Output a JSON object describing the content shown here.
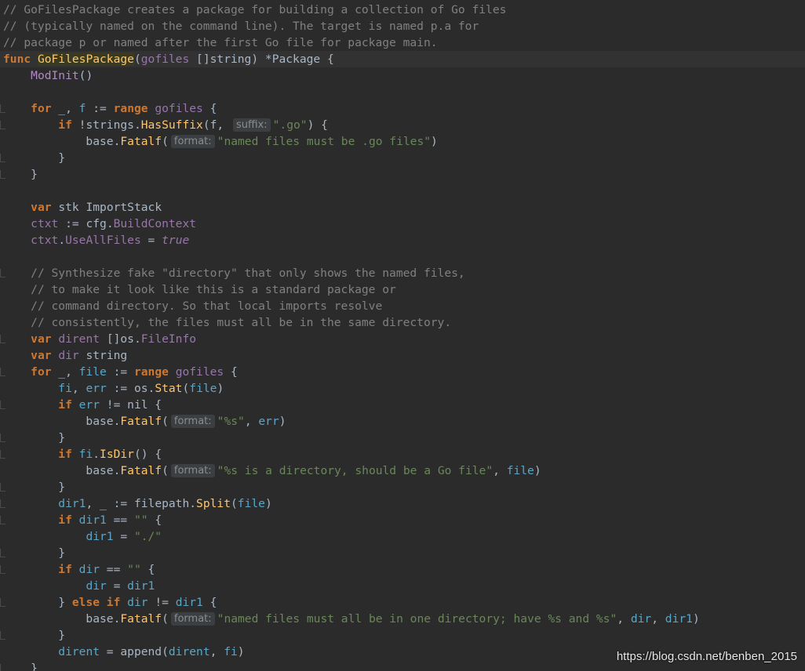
{
  "editor": {
    "language": "go",
    "current_line": 3,
    "lines": [
      [
        [
          "c",
          "// GoFilesPackage creates a package for building a collection of Go files"
        ]
      ],
      [
        [
          "c",
          "// (typically named on the command line). The target is named p.a for"
        ]
      ],
      [
        [
          "c",
          "// package p or named after the first Go file for package main."
        ]
      ],
      [
        [
          "k",
          "func "
        ],
        [
          "fn",
          "GoFilesPackage"
        ],
        [
          "pl",
          "("
        ],
        [
          "v",
          "gofiles"
        ],
        [
          "pl",
          " []string) *Package {"
        ]
      ],
      [
        [
          "pl",
          "    "
        ],
        [
          "pc",
          "ModInit"
        ],
        [
          "pl",
          "()"
        ]
      ],
      [],
      [
        [
          "pl",
          "    "
        ],
        [
          "k",
          "for "
        ],
        [
          "pl",
          "_, "
        ],
        [
          "pv",
          "f"
        ],
        [
          "pl",
          " := "
        ],
        [
          "k",
          "range "
        ],
        [
          "v",
          "gofiles"
        ],
        [
          "pl",
          " {"
        ]
      ],
      [
        [
          "pl",
          "        "
        ],
        [
          "k",
          "if "
        ],
        [
          "pl",
          "!strings."
        ],
        [
          "m",
          "HasSuffix"
        ],
        [
          "pl",
          "(f, "
        ],
        [
          "hint",
          "suffix:"
        ],
        [
          "s",
          "\".go\""
        ],
        [
          "pl",
          ") {"
        ]
      ],
      [
        [
          "pl",
          "            base."
        ],
        [
          "m",
          "Fatalf"
        ],
        [
          "pl",
          "("
        ],
        [
          "hint",
          "format:"
        ],
        [
          "s",
          "\"named files must be .go files\""
        ],
        [
          "pl",
          ")"
        ]
      ],
      [
        [
          "pl",
          "        }"
        ]
      ],
      [
        [
          "pl",
          "    }"
        ]
      ],
      [],
      [
        [
          "pl",
          "    "
        ],
        [
          "k",
          "var "
        ],
        [
          "pl",
          "stk "
        ],
        [
          "t",
          "ImportStack"
        ]
      ],
      [
        [
          "pl",
          "    "
        ],
        [
          "v",
          "ctxt"
        ],
        [
          "pl",
          " := cfg."
        ],
        [
          "v",
          "BuildContext"
        ]
      ],
      [
        [
          "pl",
          "    "
        ],
        [
          "v",
          "ctxt"
        ],
        [
          "pl",
          "."
        ],
        [
          "v",
          "UseAllFiles"
        ],
        [
          "pl",
          " = "
        ],
        [
          "i",
          "true"
        ]
      ],
      [],
      [
        [
          "pl",
          "    "
        ],
        [
          "c",
          "// Synthesize fake \"directory\" that only shows the named files,"
        ]
      ],
      [
        [
          "pl",
          "    "
        ],
        [
          "c",
          "// to make it look like this is a standard package or"
        ]
      ],
      [
        [
          "pl",
          "    "
        ],
        [
          "c",
          "// command directory. So that local imports resolve"
        ]
      ],
      [
        [
          "pl",
          "    "
        ],
        [
          "c",
          "// consistently, the files must all be in the same directory."
        ]
      ],
      [
        [
          "pl",
          "    "
        ],
        [
          "k",
          "var "
        ],
        [
          "v",
          "dirent"
        ],
        [
          "pl",
          " []os."
        ],
        [
          "v",
          "FileInfo"
        ]
      ],
      [
        [
          "pl",
          "    "
        ],
        [
          "k",
          "var "
        ],
        [
          "v",
          "dir"
        ],
        [
          "pl",
          " string"
        ]
      ],
      [
        [
          "pl",
          "    "
        ],
        [
          "k",
          "for "
        ],
        [
          "pl",
          "_, "
        ],
        [
          "pv",
          "file"
        ],
        [
          "pl",
          " := "
        ],
        [
          "k",
          "range "
        ],
        [
          "v",
          "gofiles"
        ],
        [
          "pl",
          " {"
        ]
      ],
      [
        [
          "pl",
          "        "
        ],
        [
          "pv",
          "fi"
        ],
        [
          "pl",
          ", "
        ],
        [
          "pv",
          "err"
        ],
        [
          "pl",
          " := os."
        ],
        [
          "m",
          "Stat"
        ],
        [
          "pl",
          "("
        ],
        [
          "pv",
          "file"
        ],
        [
          "pl",
          ")"
        ]
      ],
      [
        [
          "pl",
          "        "
        ],
        [
          "k",
          "if "
        ],
        [
          "pv",
          "err"
        ],
        [
          "pl",
          " != nil {"
        ]
      ],
      [
        [
          "pl",
          "            base."
        ],
        [
          "m",
          "Fatalf"
        ],
        [
          "pl",
          "("
        ],
        [
          "hint",
          "format:"
        ],
        [
          "s",
          "\"%s\""
        ],
        [
          "pl",
          ", "
        ],
        [
          "pv",
          "err"
        ],
        [
          "pl",
          ")"
        ]
      ],
      [
        [
          "pl",
          "        }"
        ]
      ],
      [
        [
          "pl",
          "        "
        ],
        [
          "k",
          "if "
        ],
        [
          "pv",
          "fi"
        ],
        [
          "pl",
          "."
        ],
        [
          "m",
          "IsDir"
        ],
        [
          "pl",
          "() {"
        ]
      ],
      [
        [
          "pl",
          "            base."
        ],
        [
          "m",
          "Fatalf"
        ],
        [
          "pl",
          "("
        ],
        [
          "hint",
          "format:"
        ],
        [
          "s",
          "\"%s is a directory, should be a Go file\""
        ],
        [
          "pl",
          ", "
        ],
        [
          "pv",
          "file"
        ],
        [
          "pl",
          ")"
        ]
      ],
      [
        [
          "pl",
          "        }"
        ]
      ],
      [
        [
          "pl",
          "        "
        ],
        [
          "pv",
          "dir1"
        ],
        [
          "pl",
          ", _ := filepath."
        ],
        [
          "m",
          "Split"
        ],
        [
          "pl",
          "("
        ],
        [
          "pv",
          "file"
        ],
        [
          "pl",
          ")"
        ]
      ],
      [
        [
          "pl",
          "        "
        ],
        [
          "k",
          "if "
        ],
        [
          "pv",
          "dir1"
        ],
        [
          "pl",
          " == "
        ],
        [
          "s",
          "\"\""
        ],
        [
          "pl",
          " {"
        ]
      ],
      [
        [
          "pl",
          "            "
        ],
        [
          "pv",
          "dir1"
        ],
        [
          "pl",
          " = "
        ],
        [
          "s",
          "\"./\""
        ]
      ],
      [
        [
          "pl",
          "        }"
        ]
      ],
      [
        [
          "pl",
          "        "
        ],
        [
          "k",
          "if "
        ],
        [
          "pv",
          "dir"
        ],
        [
          "pl",
          " == "
        ],
        [
          "s",
          "\"\""
        ],
        [
          "pl",
          " {"
        ]
      ],
      [
        [
          "pl",
          "            "
        ],
        [
          "pv",
          "dir"
        ],
        [
          "pl",
          " = "
        ],
        [
          "pv",
          "dir1"
        ]
      ],
      [
        [
          "pl",
          "        } "
        ],
        [
          "k",
          "else if "
        ],
        [
          "pv",
          "dir"
        ],
        [
          "pl",
          " != "
        ],
        [
          "pv",
          "dir1"
        ],
        [
          "pl",
          " {"
        ]
      ],
      [
        [
          "pl",
          "            base."
        ],
        [
          "m",
          "Fatalf"
        ],
        [
          "pl",
          "("
        ],
        [
          "hint",
          "format:"
        ],
        [
          "s",
          "\"named files must all be in one directory; have %s and %s\""
        ],
        [
          "pl",
          ", "
        ],
        [
          "pv",
          "dir"
        ],
        [
          "pl",
          ", "
        ],
        [
          "pv",
          "dir1"
        ],
        [
          "pl",
          ")"
        ]
      ],
      [
        [
          "pl",
          "        }"
        ]
      ],
      [
        [
          "pl",
          "        "
        ],
        [
          "pv",
          "dirent"
        ],
        [
          "pl",
          " = append("
        ],
        [
          "pv",
          "dirent"
        ],
        [
          "pl",
          ", "
        ],
        [
          "pv",
          "fi"
        ],
        [
          "pl",
          ")"
        ]
      ],
      [
        [
          "pl",
          "    }"
        ]
      ]
    ]
  },
  "watermark": {
    "text": "https://blog.csdn.net/benben_2015"
  }
}
